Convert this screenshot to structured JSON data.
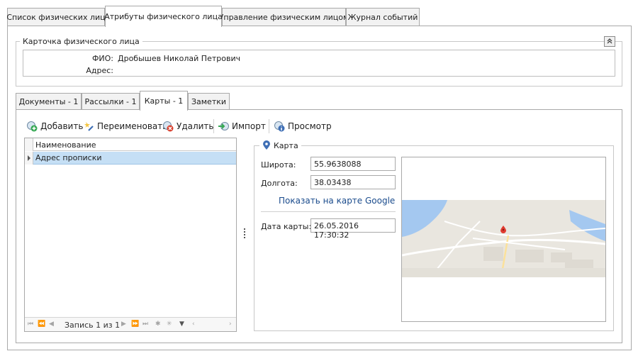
{
  "top_tabs": [
    {
      "label": "Список физических лиц"
    },
    {
      "label": "Атрибуты физического лица"
    },
    {
      "label": "Управление физическим лицом"
    },
    {
      "label": "Журнал событий"
    }
  ],
  "card": {
    "title": "Карточка физического лица",
    "collapse_glyph": "⌃",
    "fio_label": "ФИО:",
    "fio_value": "Дробышев Николай Петрович",
    "address_label": "Адрес:",
    "address_value": ""
  },
  "inner_tabs": [
    {
      "label": "Документы - 1"
    },
    {
      "label": "Рассылки - 1"
    },
    {
      "label": "Карты - 1"
    },
    {
      "label": "Заметки"
    }
  ],
  "toolbar": {
    "add": "Добавить",
    "rename": "Переименовать",
    "delete": "Удалить",
    "import": "Импорт",
    "view": "Просмотр"
  },
  "grid": {
    "column": "Наименование",
    "rows": [
      {
        "name": "Адрес прописки"
      }
    ],
    "record_text": "Запись 1 из 1"
  },
  "map_panel": {
    "title": "Карта",
    "lat_label": "Широта:",
    "lat_value": "55.9638088",
    "lon_label": "Долгота:",
    "lon_value": "38.03438",
    "google_link": "Показать на карте Google",
    "date_label": "Дата карты:",
    "date_value": "26.05.2016 17:30:32"
  },
  "colors": {
    "selected_row": "#c5dff5",
    "link": "#1a4b8c",
    "border": "#a9a9a9",
    "map_water": "#a4c8f0",
    "map_pin": "#e03a2f"
  }
}
